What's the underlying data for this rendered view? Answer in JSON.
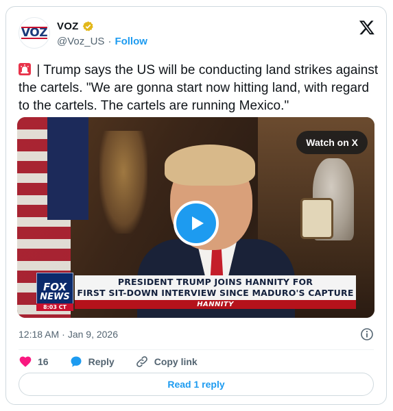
{
  "account": {
    "display_name": "VOZ",
    "avatar_text": "VOZ",
    "handle": "@Voz_US",
    "separator": "·",
    "follow_label": "Follow",
    "verified_badge": "gold-verified-icon"
  },
  "tweet": {
    "text": " | Trump says the US will be conducting land strikes against the cartels. \"We are gonna start now hitting land, with regard to the cartels. The cartels are running Mexico.\"",
    "lead_icon": "siren-icon"
  },
  "video": {
    "watch_label": "Watch on X",
    "chyron_line1": "PRESIDENT TRUMP JOINS HANNITY FOR",
    "chyron_line2": "FIRST SIT-DOWN INTERVIEW SINCE MADURO'S CAPTURE",
    "show_name": "HANNITY",
    "network_line1": "FOX",
    "network_line2": "NEWS",
    "network_time": "8:03 CT"
  },
  "meta": {
    "time": "12:18 AM",
    "separator": "·",
    "date": "Jan 9, 2026"
  },
  "actions": {
    "like_count": "16",
    "reply_label": "Reply",
    "copy_link_label": "Copy link"
  },
  "read_replies_label": "Read 1 reply",
  "colors": {
    "accent": "#1d9bf0",
    "like": "#f91880",
    "text": "#0f1419",
    "muted": "#536471"
  }
}
